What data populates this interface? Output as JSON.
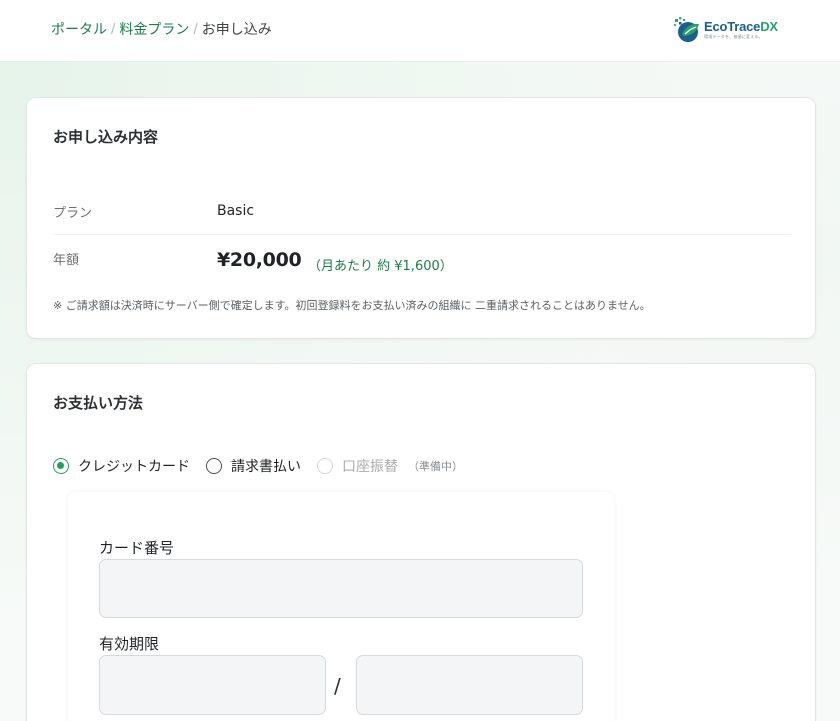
{
  "breadcrumb": {
    "portal": "ポータル",
    "pricing": "料金プラン",
    "current": "お申し込み",
    "separator": "/"
  },
  "logo": {
    "eco": "EcoTrace",
    "dx": "DX",
    "tagline": "環境データを、価値に変える。"
  },
  "summary": {
    "title": "お申し込み内容",
    "plan_label": "プラン",
    "plan_value": "Basic",
    "price_label": "年額",
    "price_value": "¥20,000",
    "price_monthly": "（月あたり 約 ¥1,600）",
    "note": "※ ご請求額は決済時にサーバー側で確定します。初回登録料をお支払い済みの組織に 二重請求されることはありません。"
  },
  "payment": {
    "title": "お支払い方法",
    "methods": [
      {
        "label": "クレジットカード",
        "selected": true,
        "disabled": false
      },
      {
        "label": "請求書払い",
        "selected": false,
        "disabled": false
      },
      {
        "label": "口座振替",
        "selected": false,
        "disabled": true,
        "note": "（準備中）"
      }
    ],
    "card_number_label": "カード番号",
    "card_number_value": "",
    "expiry_label": "有効期限",
    "expiry_month_value": "",
    "expiry_year_value": "",
    "expiry_separator": "/"
  },
  "colors": {
    "accent": "#2a9a62",
    "link": "#1f7a4a",
    "logo_blue": "#1e5f8a",
    "logo_green": "#27a26a"
  }
}
